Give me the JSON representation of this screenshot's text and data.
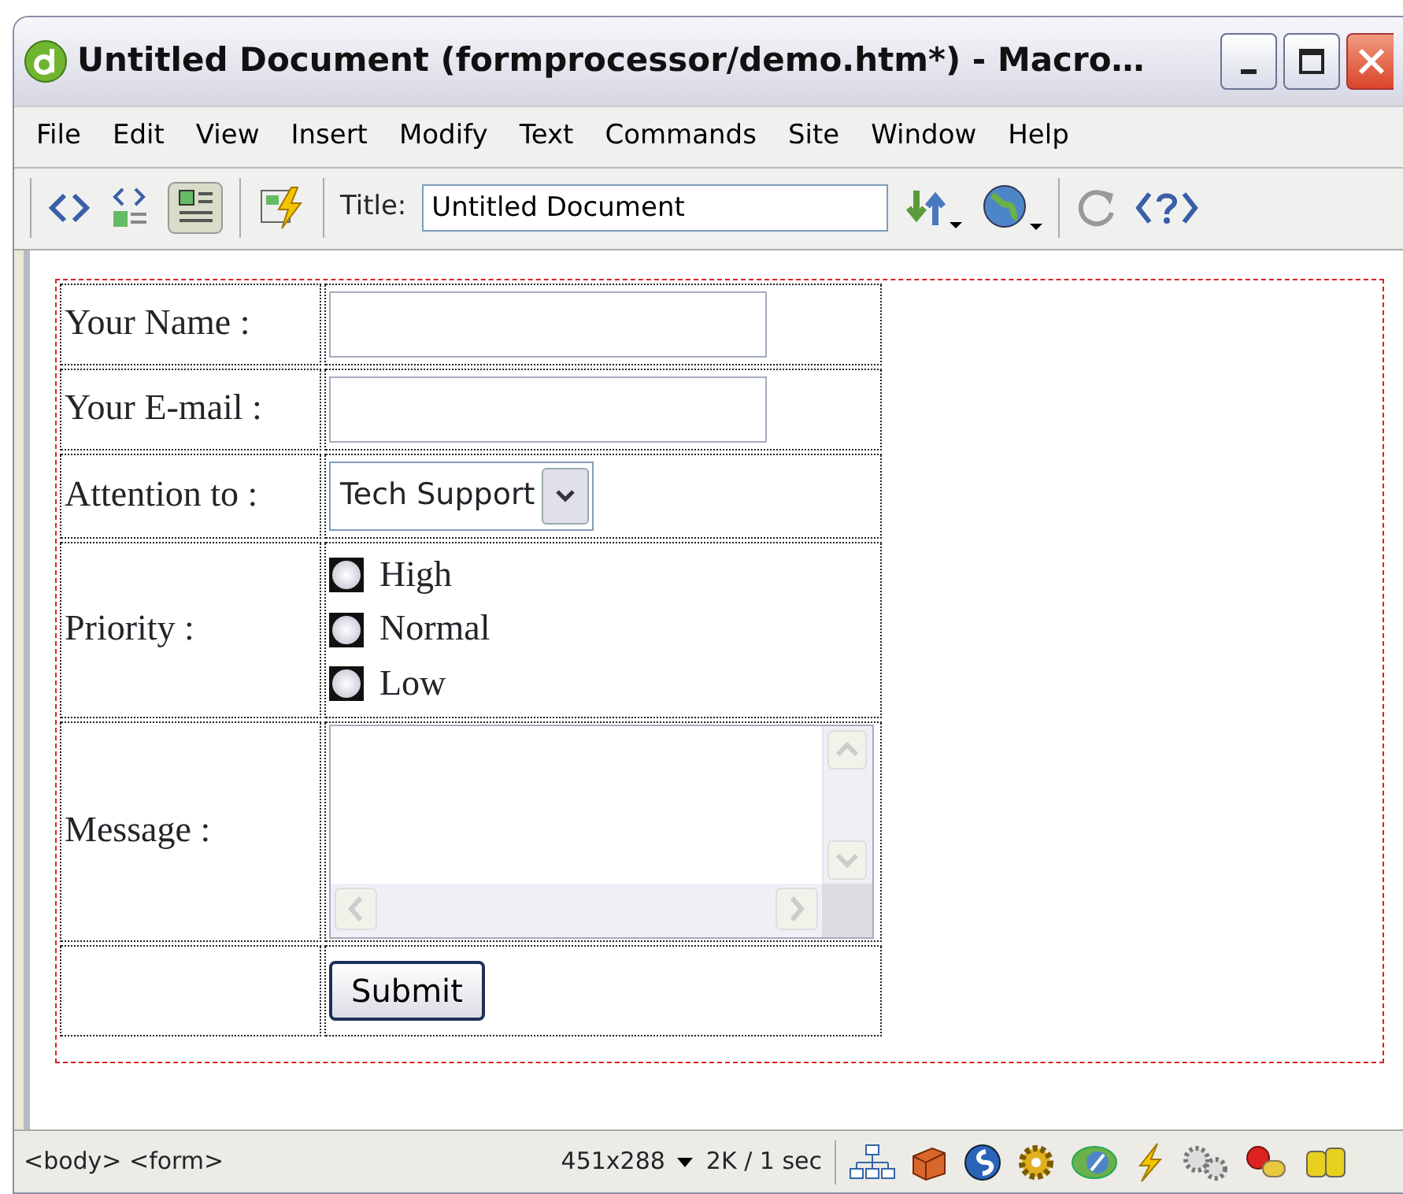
{
  "window": {
    "title": "Untitled Document (formprocessor/demo.htm*) - Macro…"
  },
  "menu": [
    "File",
    "Edit",
    "View",
    "Insert",
    "Modify",
    "Text",
    "Commands",
    "Site",
    "Window",
    "Help"
  ],
  "toolbar": {
    "title_label": "Title:",
    "title_value": "Untitled Document"
  },
  "form": {
    "rows": [
      {
        "kind": "text",
        "label": "Your Name :"
      },
      {
        "kind": "text",
        "label": "Your E-mail :"
      },
      {
        "kind": "select",
        "label": "Attention to :",
        "value": "Tech Support"
      },
      {
        "kind": "radio",
        "label": "Priority :",
        "options": [
          {
            "label": "High",
            "selected": false
          },
          {
            "label": "Normal",
            "selected": false
          },
          {
            "label": "Low",
            "selected": false
          }
        ]
      },
      {
        "kind": "textarea",
        "label": "Message :"
      },
      {
        "kind": "submit",
        "button": "Submit"
      }
    ]
  },
  "status_bar": {
    "tags": "<body> <form>",
    "size": "451x288",
    "speed": "2K / 1 sec"
  }
}
